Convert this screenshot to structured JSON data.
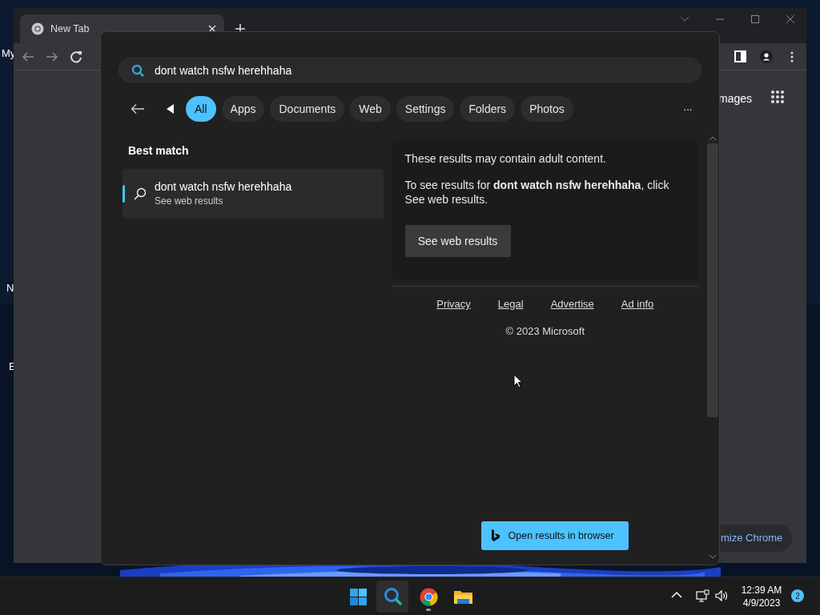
{
  "desktop": {
    "icon_labels": [
      "My",
      "N",
      "E"
    ]
  },
  "browser": {
    "tab": {
      "title": "New Tab"
    },
    "images_link": "mages",
    "customize_button": "mize Chrome"
  },
  "search": {
    "query": "dont watch nsfw herehhaha",
    "filters": [
      {
        "label": "All",
        "selected": true
      },
      {
        "label": "Apps",
        "selected": false
      },
      {
        "label": "Documents",
        "selected": false
      },
      {
        "label": "Web",
        "selected": false
      },
      {
        "label": "Settings",
        "selected": false
      },
      {
        "label": "Folders",
        "selected": false
      },
      {
        "label": "Photos",
        "selected": false
      }
    ],
    "more": "···",
    "best_match": {
      "heading": "Best match",
      "title": "dont watch nsfw herehhaha",
      "subtitle": "See web results",
      "selected": true
    },
    "notice": {
      "line1": "These results may contain adult content.",
      "line2": "To see results for **dont watch nsfw herehhaha**, click See web results.",
      "button": "See web results"
    },
    "footer": {
      "links": [
        "Privacy",
        "Legal",
        "Advertise",
        "Ad info"
      ],
      "copyright": "© 2023 Microsoft"
    },
    "open_button": "Open results in browser"
  },
  "taskbar": {
    "apps": [
      {
        "kind": "start",
        "selected": false,
        "running": false
      },
      {
        "kind": "search",
        "selected": true,
        "running": false
      },
      {
        "kind": "chrome",
        "selected": false,
        "running": true
      },
      {
        "kind": "explorer",
        "selected": false,
        "running": false
      }
    ],
    "time": "12:39 AM",
    "date": "4/9/2023",
    "notification_count": "2"
  }
}
